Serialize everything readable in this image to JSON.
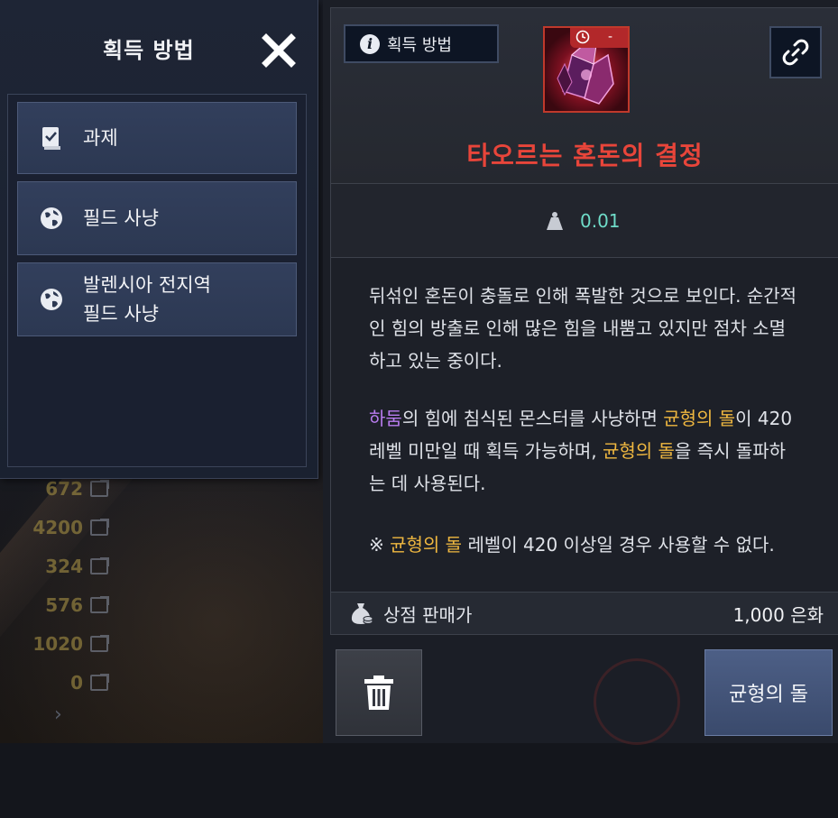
{
  "background_list": {
    "values": [
      "672",
      "4200",
      "324",
      "576",
      "1020",
      "0"
    ]
  },
  "acquisition_panel": {
    "title": "획득 방법",
    "items": [
      {
        "label": "과제",
        "icon": "quest-book-icon"
      },
      {
        "label": "필드 사냥",
        "icon": "globe-icon"
      },
      {
        "label": "발렌시아 전지역\n필드 사냥",
        "icon": "globe-icon"
      }
    ]
  },
  "item_detail": {
    "acquisition_button_label": "획득 방법",
    "timer_text": "-",
    "name": "타오르는 혼돈의 결정",
    "name_color": "#e8453a",
    "weight": "0.01",
    "description": {
      "para1": "뒤섞인 혼돈이 충돌로 인해 폭발한 것으로 보인다. 순간적인 힘의 방출로 인해 많은 힘을 내뿜고 있지만 점차 소멸하고 있는 중이다.",
      "para2_highlight1": "하둠",
      "para2_text1": "의 힘에 침식된 몬스터를 사냥하면 ",
      "para2_highlight2": "균형의 돌",
      "para2_text2": "이 420레벨 미만일 때 획득 가능하며, ",
      "para2_highlight3": "균형의 돌",
      "para2_text3": "을 즉시 돌파하는 데 사용된다.",
      "para3_prefix": "※ ",
      "para3_highlight": "균형의 돌",
      "para3_text": " 레벨이 420 이상일 경우 사용할 수 없다."
    },
    "sell_label": "상점 판매가",
    "sell_price": "1,000 은화",
    "primary_button_label": "균형의 돌"
  },
  "colors": {
    "highlight_purple": "#b97cf0",
    "highlight_gold": "#f0b840",
    "weight_value": "#6fdcc8"
  }
}
